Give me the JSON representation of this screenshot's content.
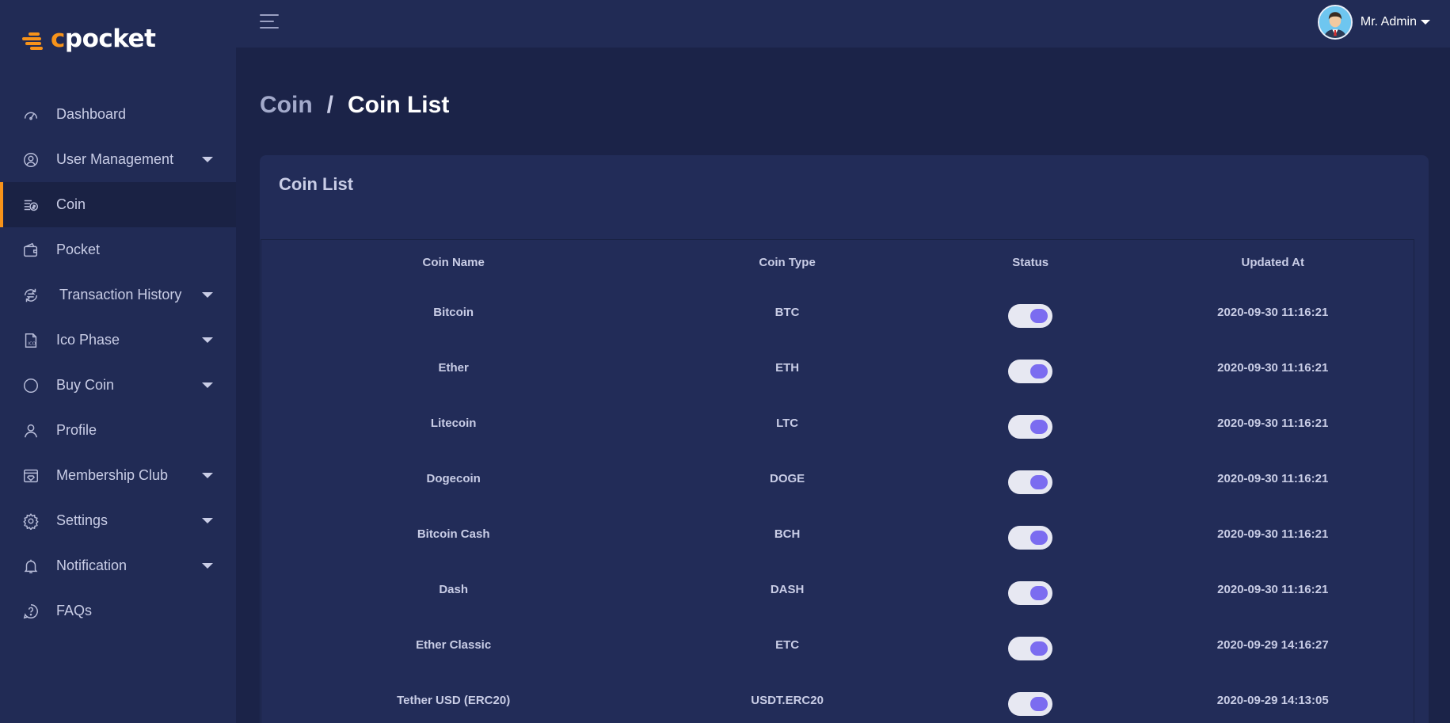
{
  "brand": {
    "logo_c": "c",
    "logo_rest": "pocket"
  },
  "sidebar": {
    "items": [
      {
        "label": "Dashboard",
        "icon": "speedometer-icon",
        "caret": false,
        "active": false
      },
      {
        "label": "User Management",
        "icon": "user-circle-icon",
        "caret": true,
        "active": false
      },
      {
        "label": "Coin",
        "icon": "coins-icon",
        "caret": false,
        "active": true
      },
      {
        "label": "Pocket",
        "icon": "wallet-icon",
        "caret": false,
        "active": false
      },
      {
        "label": "Transaction History",
        "icon": "exchange-icon",
        "caret": true,
        "active": false
      },
      {
        "label": "Ico Phase",
        "icon": "ico-file-icon",
        "caret": true,
        "active": false
      },
      {
        "label": "Buy Coin",
        "icon": "circle-icon",
        "caret": true,
        "active": false
      },
      {
        "label": "Profile",
        "icon": "person-icon",
        "caret": false,
        "active": false
      },
      {
        "label": "Membership Club",
        "icon": "diamond-card-icon",
        "caret": true,
        "active": false
      },
      {
        "label": "Settings",
        "icon": "gear-icon",
        "caret": true,
        "active": false
      },
      {
        "label": "Notification",
        "icon": "bell-icon",
        "caret": true,
        "active": false
      },
      {
        "label": "FAQs",
        "icon": "question-bubble-icon",
        "caret": false,
        "active": false
      }
    ]
  },
  "topbar": {
    "user_name": "Mr. Admin"
  },
  "breadcrumb": {
    "parent": "Coin",
    "separator": "/",
    "current": "Coin List"
  },
  "card": {
    "title": "Coin List",
    "columns": [
      "Coin Name",
      "Coin Type",
      "Status",
      "Updated At"
    ],
    "rows": [
      {
        "name": "Bitcoin",
        "type": "BTC",
        "status": true,
        "updated": "2020-09-30 11:16:21"
      },
      {
        "name": "Ether",
        "type": "ETH",
        "status": true,
        "updated": "2020-09-30 11:16:21"
      },
      {
        "name": "Litecoin",
        "type": "LTC",
        "status": true,
        "updated": "2020-09-30 11:16:21"
      },
      {
        "name": "Dogecoin",
        "type": "DOGE",
        "status": true,
        "updated": "2020-09-30 11:16:21"
      },
      {
        "name": "Bitcoin Cash",
        "type": "BCH",
        "status": true,
        "updated": "2020-09-30 11:16:21"
      },
      {
        "name": "Dash",
        "type": "DASH",
        "status": true,
        "updated": "2020-09-30 11:16:21"
      },
      {
        "name": "Ether Classic",
        "type": "ETC",
        "status": true,
        "updated": "2020-09-29 14:16:27"
      },
      {
        "name": "Tether USD (ERC20)",
        "type": "USDT.ERC20",
        "status": true,
        "updated": "2020-09-29 14:13:05"
      }
    ]
  },
  "colors": {
    "accent": "#f7931a",
    "toggle_knob": "#7b6cf0",
    "sidebar_bg": "#212b55",
    "page_bg": "#1b2348"
  }
}
